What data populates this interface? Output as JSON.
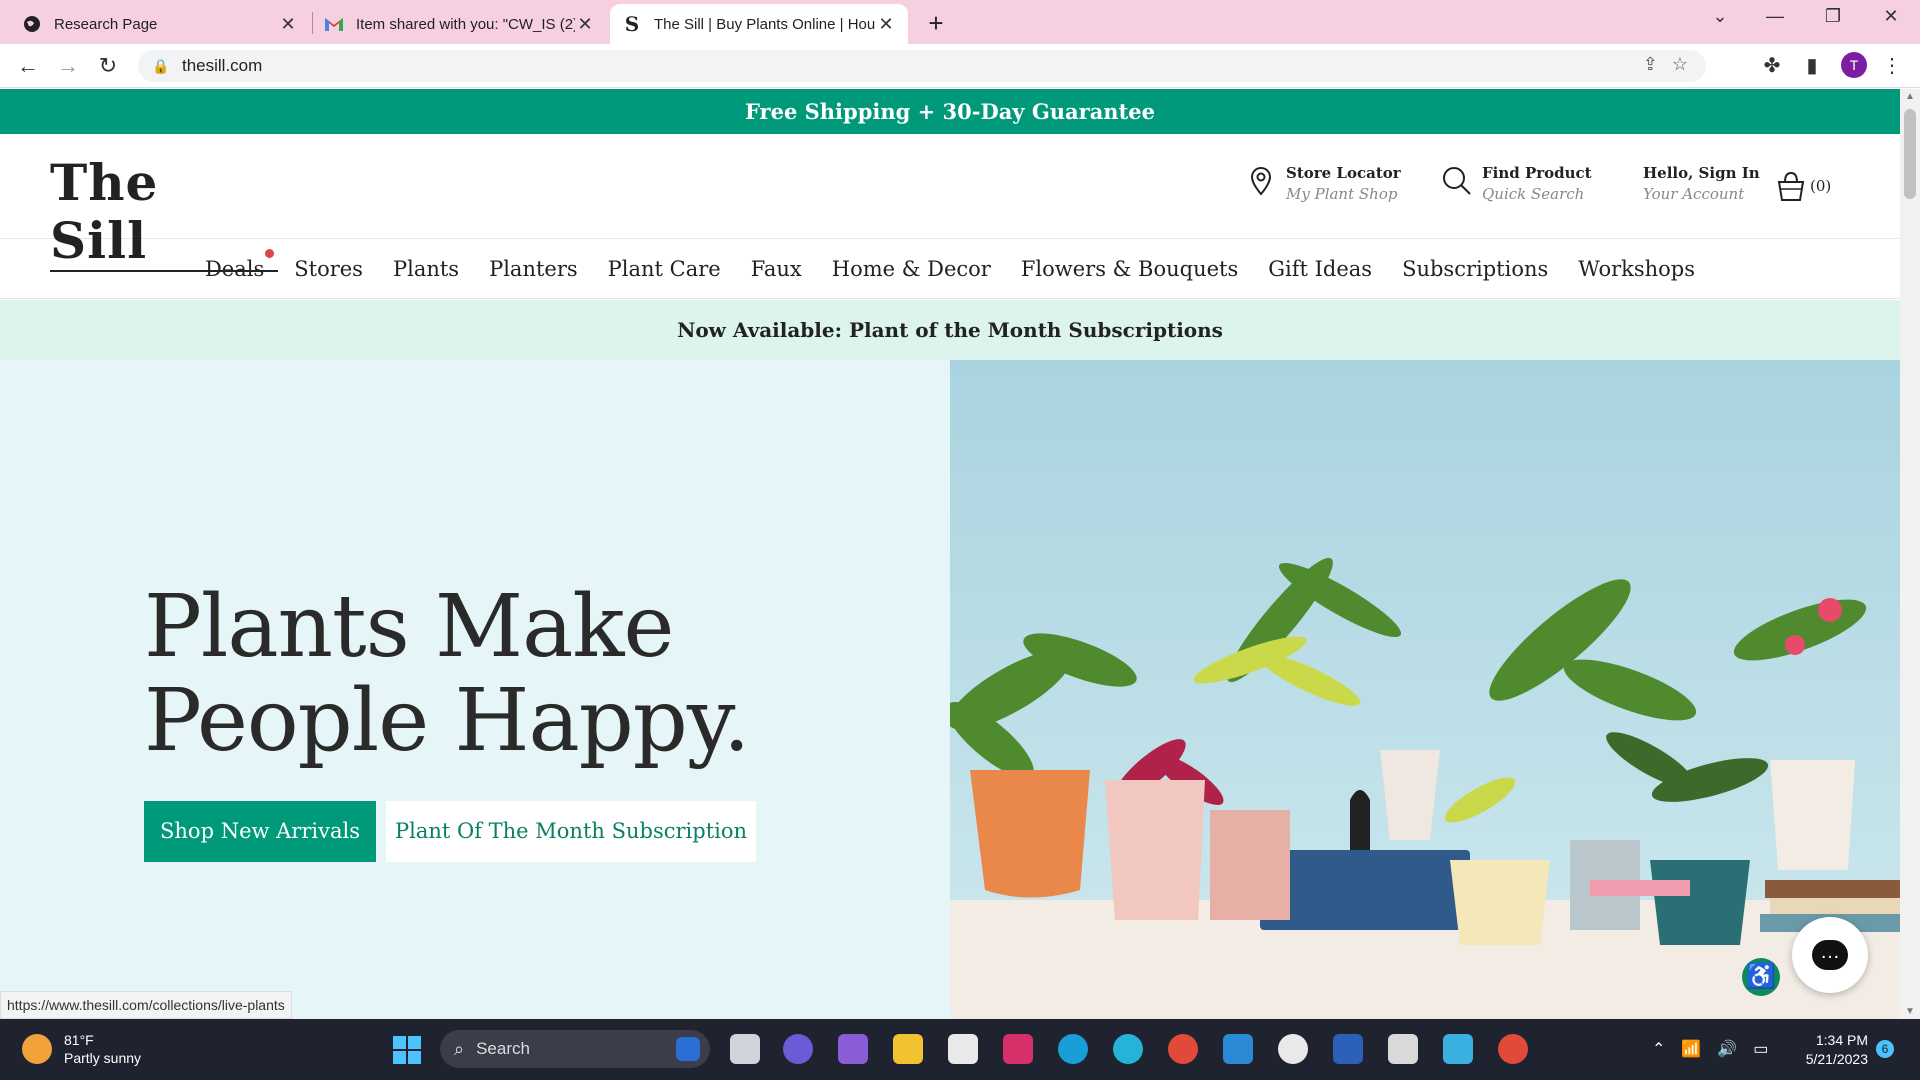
{
  "browser": {
    "tabs": [
      {
        "title": "Research Page"
      },
      {
        "title": "Item shared with you: \"CW_IS (2)"
      },
      {
        "title": "The Sill | Buy Plants Online | Hou"
      }
    ],
    "url": "thesill.com",
    "avatar_letter": "T"
  },
  "site": {
    "promo": "Free Shipping + 30-Day Guarantee",
    "logo": {
      "word1": "The",
      "word2": "Sill"
    },
    "header": {
      "store_locator": {
        "title": "Store Locator",
        "subtitle": "My Plant Shop"
      },
      "find_product": {
        "title": "Find Product",
        "subtitle": "Quick Search"
      },
      "account": {
        "title": "Hello, Sign In",
        "subtitle": "Your Account"
      },
      "cart": "(0)"
    },
    "nav": [
      "Deals",
      "Stores",
      "Plants",
      "Planters",
      "Plant Care",
      "Faux",
      "Home & Decor",
      "Flowers & Bouquets",
      "Gift Ideas",
      "Subscriptions",
      "Workshops"
    ],
    "subbanner": "Now Available: Plant of the Month Subscriptions",
    "hero": {
      "line1": "Plants Make",
      "line2": "People Happy.",
      "primary_button": "Shop New Arrivals",
      "secondary_button": "Plant Of The Month Subscription"
    },
    "status_url": "https://www.thesill.com/collections/live-plants"
  },
  "taskbar": {
    "weather": {
      "temp": "81°F",
      "desc": "Partly sunny"
    },
    "search_placeholder": "Search",
    "time": "1:34 PM",
    "date": "5/21/2023",
    "notifications": "6"
  },
  "colors": {
    "brand_green": "#009a7b",
    "tabbar_pink": "#f6cfe0",
    "hero_bg": "#e6f5f7",
    "subbanner_bg": "#ddf3ee"
  }
}
